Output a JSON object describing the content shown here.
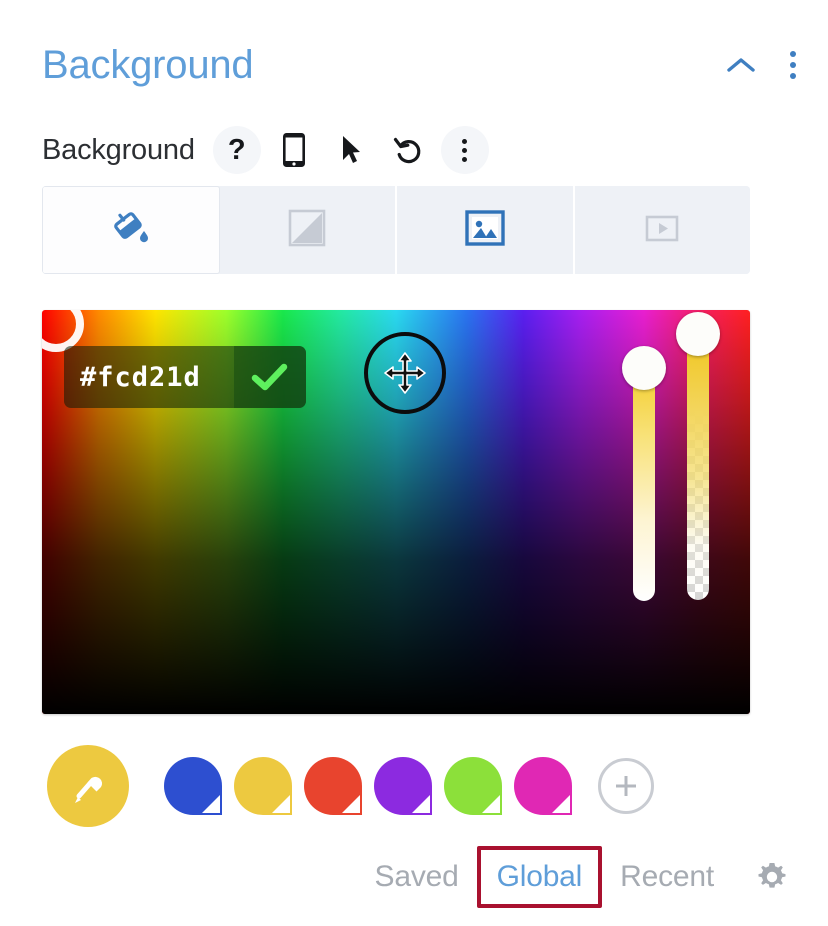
{
  "module": {
    "title": "Background",
    "collapse_icon": "chevron-up-icon",
    "menu_icon": "kebab-menu-icon"
  },
  "toolbar": {
    "label": "Background",
    "items": [
      {
        "name": "help-icon",
        "glyph": "?"
      },
      {
        "name": "responsive-mobile-icon",
        "glyph": "mobile"
      },
      {
        "name": "hover-cursor-icon",
        "glyph": "cursor"
      },
      {
        "name": "reset-undo-icon",
        "glyph": "undo"
      },
      {
        "name": "options-kebab-icon",
        "glyph": "kebab"
      }
    ]
  },
  "background_tabs": [
    {
      "name": "color-fill-tab",
      "icon": "paint-bucket-icon",
      "active": true
    },
    {
      "name": "gradient-tab",
      "icon": "gradient-icon",
      "active": false
    },
    {
      "name": "image-tab",
      "icon": "image-icon",
      "active": false
    },
    {
      "name": "video-tab",
      "icon": "video-icon",
      "active": false
    }
  ],
  "picker": {
    "hex_value": "#fcd21d",
    "confirm_icon": "checkmark-icon",
    "move_cursor_icon": "move-cursor-icon",
    "sv_handle_name": "saturation-value-handle",
    "value_slider_name": "value-slider",
    "alpha_slider_name": "alpha-slider"
  },
  "swatches": {
    "eyedropper": {
      "name": "eyedropper-swatch",
      "color": "#edc940",
      "icon": "eyedropper-icon"
    },
    "colors": [
      {
        "name": "swatch-blue",
        "color": "#2d4fd0"
      },
      {
        "name": "swatch-gold",
        "color": "#edc940"
      },
      {
        "name": "swatch-red",
        "color": "#e8442e"
      },
      {
        "name": "swatch-purple",
        "color": "#8c2ae0"
      },
      {
        "name": "swatch-green",
        "color": "#8ce03a"
      },
      {
        "name": "swatch-magenta",
        "color": "#e028b4"
      }
    ],
    "add_label": "+"
  },
  "bottom_tabs": {
    "items": [
      {
        "name": "tab-saved",
        "label": "Saved",
        "selected": false
      },
      {
        "name": "tab-global",
        "label": "Global",
        "selected": true
      },
      {
        "name": "tab-recent",
        "label": "Recent",
        "selected": false
      }
    ],
    "settings_icon": "gear-icon"
  },
  "colors": {
    "accent_blue": "#5f9ed9",
    "annotation_red": "#a9112f",
    "tab_inactive_bg": "#eef1f6"
  }
}
